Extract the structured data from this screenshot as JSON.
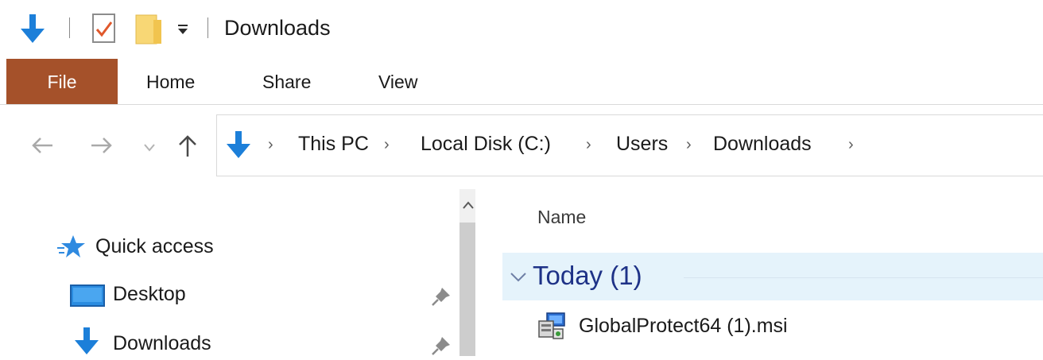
{
  "window": {
    "title": "Downloads"
  },
  "quick_access_toolbar": {
    "icons": [
      "download-arrow-icon",
      "properties-icon",
      "new-folder-icon",
      "customize-dropdown-icon"
    ]
  },
  "ribbon": {
    "tabs": [
      {
        "label": "File",
        "active": true
      },
      {
        "label": "Home"
      },
      {
        "label": "Share"
      },
      {
        "label": "View"
      }
    ],
    "file_tab_color": "#a5512a"
  },
  "address_bar": {
    "icons": [
      "back-icon",
      "forward-icon",
      "recent-dropdown-icon",
      "up-icon",
      "downloads-location-icon"
    ],
    "breadcrumbs": [
      "This PC",
      "Local Disk (C:)",
      "Users",
      "Downloads"
    ]
  },
  "nav_pane": {
    "items": [
      {
        "label": "Quick access",
        "icon": "star-icon"
      },
      {
        "label": "Desktop",
        "icon": "desktop-icon",
        "pinned": true
      },
      {
        "label": "Downloads",
        "icon": "download-arrow-icon",
        "pinned": true
      }
    ]
  },
  "content": {
    "columns": [
      "Name"
    ],
    "groups": [
      {
        "label": "Today (1)",
        "files": [
          {
            "name": "GlobalProtect64 (1).msi",
            "icon": "msi-installer-icon"
          }
        ]
      }
    ],
    "group_color": "#1e3287",
    "group_bg": "#e5f3fb"
  }
}
